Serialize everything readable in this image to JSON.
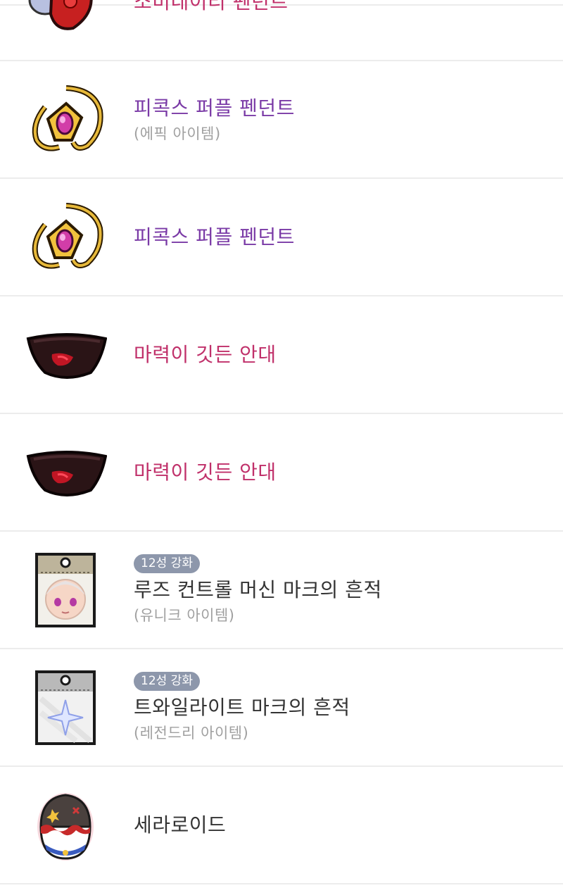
{
  "items": [
    {
      "name": "소미네이티 펜던트",
      "sub": "",
      "badge": "",
      "name_color": "#c0306a",
      "icon": "red-pendant-icon"
    },
    {
      "name": "피콕스 퍼플 펜던트",
      "sub": "(에픽 아이템)",
      "badge": "",
      "name_color": "#7a3aa6",
      "icon": "purple-pendant-icon"
    },
    {
      "name": "피콕스 퍼플 펜던트",
      "sub": "",
      "badge": "",
      "name_color": "#7a3aa6",
      "icon": "purple-pendant-icon"
    },
    {
      "name": "마력이 깃든 안대",
      "sub": "",
      "badge": "",
      "name_color": "#c0306a",
      "icon": "eyepatch-icon"
    },
    {
      "name": "마력이 깃든 안대",
      "sub": "",
      "badge": "",
      "name_color": "#c0306a",
      "icon": "eyepatch-icon"
    },
    {
      "name": "루즈 컨트롤 머신 마크의 흔적",
      "sub": "(유니크 아이템)",
      "badge": "12성 강화",
      "name_color": "#333333",
      "icon": "face-card-icon"
    },
    {
      "name": "트와일라이트 마크의 흔적",
      "sub": "(레전드리 아이템)",
      "badge": "12성 강화",
      "name_color": "#333333",
      "icon": "sparkle-card-icon"
    },
    {
      "name": "세라로이드",
      "sub": "",
      "badge": "",
      "name_color": "#333333",
      "icon": "seraroid-icon"
    }
  ]
}
